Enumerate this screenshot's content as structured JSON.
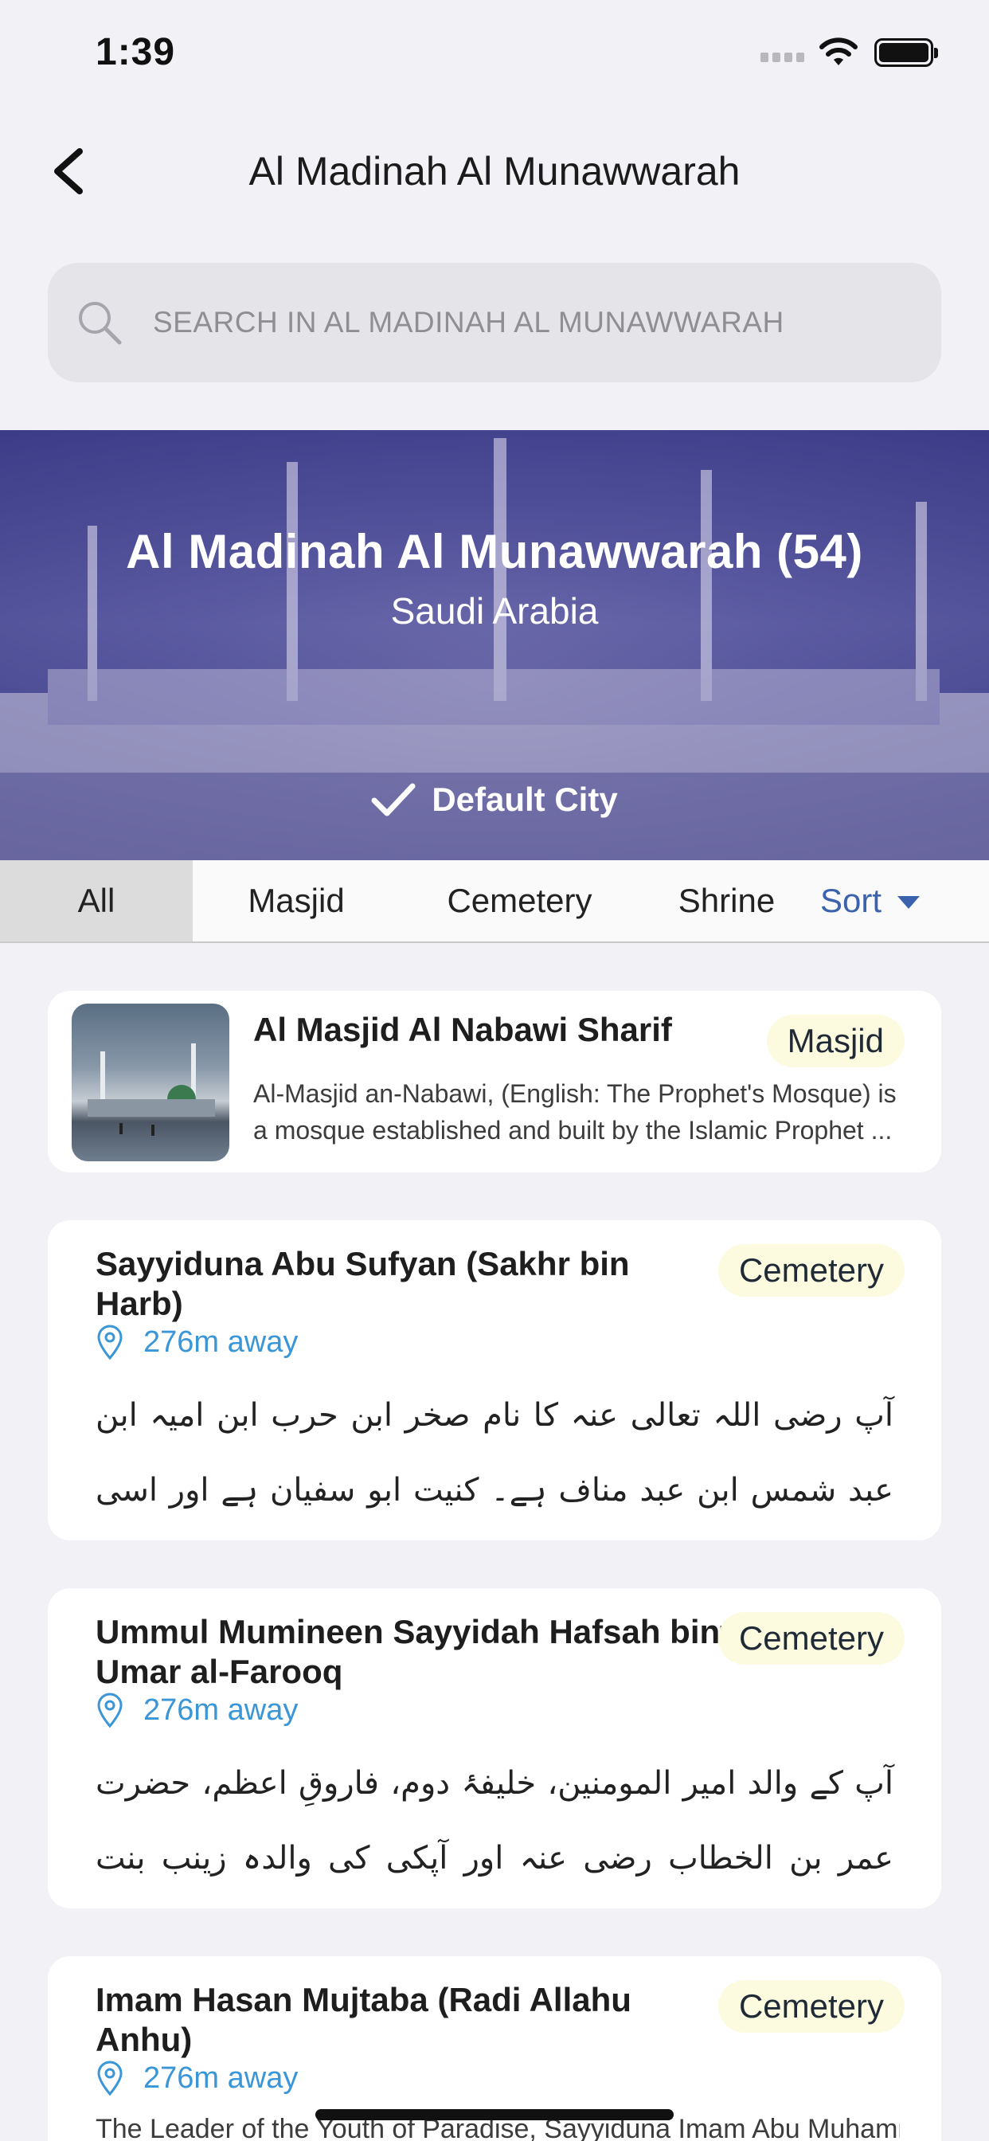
{
  "status_bar": {
    "time": "1:39"
  },
  "nav": {
    "title": "Al Madinah Al Munawwarah"
  },
  "search": {
    "placeholder": "SEARCH IN AL MADINAH AL MUNAWWARAH"
  },
  "banner": {
    "title": "Al Madinah Al Munawwarah (54)",
    "subtitle": "Saudi Arabia",
    "default_label": "Default City"
  },
  "tabs": [
    {
      "label": "All",
      "active": true
    },
    {
      "label": "Masjid",
      "active": false
    },
    {
      "label": "Cemetery",
      "active": false
    },
    {
      "label": "Shrine",
      "active": false
    }
  ],
  "sort_label": "Sort",
  "places": [
    {
      "title": "Al Masjid Al Nabawi Sharif",
      "category": "Masjid",
      "description": "Al-Masjid an-Nabawi, (English: The Prophet's Mosque) is a mosque established and built by the Islamic Prophet ..."
    },
    {
      "title": "Sayyiduna Abu Sufyan (Sakhr bin Harb)",
      "category": "Cemetery",
      "distance": "276m away",
      "description": "آپ رضی اللہ تعالی عنہ کا نام صخر ابن حرب ابن امیہ ابن عبد شمس ابن عبد مناف ہے۔ کنیت ابو سفیان ہے اور اسی سے معروف ہیں۔ آپ رضی اللہ تعالی عنہ ..."
    },
    {
      "title": "Ummul Mumineen Sayyidah Hafsah bint Umar al-Farooq",
      "category": "Cemetery",
      "distance": "276m away",
      "description": "آپ کے والد امیر المومنین، خلیفۂ دوم، فاروقِ اعظم، حضرت عمر بن الخطاب رضی عنہ اور آپکی کی والدہ زینب بنت مظعون رضی اللہ تعالی عنہا ہیں۔"
    },
    {
      "title": "Imam Hasan Mujtaba (Radi Allahu Anhu)",
      "category": "Cemetery",
      "distance": "276m away",
      "description": "The Leader of the Youth of Paradise, Sayyiduna Imam Abu Muhammad"
    }
  ],
  "colors": {
    "accent": "#3b63ad",
    "distance": "#3a96d6",
    "badge_bg": "#fdfbdf"
  },
  "icons": [
    "back-chevron-icon",
    "search-icon",
    "checkmark-icon",
    "location-pin-icon",
    "caret-down-icon",
    "wifi-icon",
    "battery-icon"
  ]
}
